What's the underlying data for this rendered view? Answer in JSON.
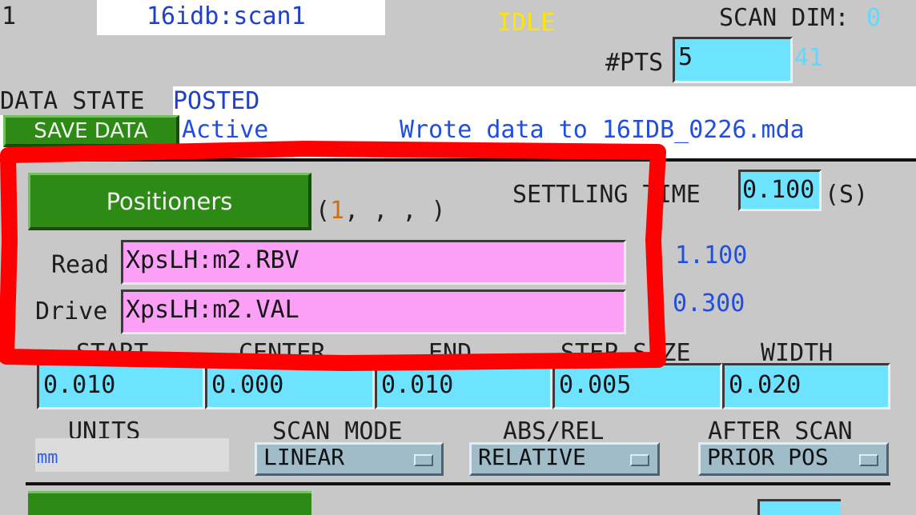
{
  "header": {
    "scan_index": "1",
    "scan_pv": "16idb:scan1",
    "status": "IDLE",
    "scan_dim_label": "SCAN DIM:",
    "scan_dim_value": "0",
    "npts_label": "#PTS",
    "npts_value": "5",
    "npts_max": "41"
  },
  "data_state": {
    "label": "DATA STATE",
    "value": "POSTED",
    "save_button": "SAVE DATA",
    "active": "Active",
    "message": "Wrote data to 16IDB_0226.mda"
  },
  "positioner": {
    "button_label": "Positioners",
    "num_prefix": "(",
    "num_highlight": "1",
    "num_rest": ", , , )",
    "settling_label": "SETTLING TIME",
    "settling_value": "0.100",
    "settling_unit": "(S)",
    "read_label": "Read",
    "read_pv": "XpsLH:m2.RBV",
    "read_value": "1.100",
    "drive_label": "Drive",
    "drive_pv": "XpsLH:m2.VAL",
    "drive_value": "0.300",
    "col_labels": [
      "START",
      "CENTER",
      "END",
      "STEP SIZE",
      "WIDTH"
    ],
    "values": [
      "0.010",
      "0.000",
      "0.010",
      "0.005",
      "0.020"
    ],
    "units_label": "UNITS",
    "units_value": "mm",
    "scan_mode_label": "SCAN MODE",
    "scan_mode_value": "LINEAR",
    "absrel_label": "ABS/REL",
    "absrel_value": "RELATIVE",
    "after_scan_label": "AFTER SCAN",
    "after_scan_value": "PRIOR POS"
  },
  "overlay": {
    "highlight_color": "#ff0000"
  },
  "colors": {
    "panel_bg": "#c8c8c8",
    "field_bg": "#6ee3ff",
    "pv_field_bg": "#fca0f7",
    "button_green": "#2c8a15",
    "status_yellow": "#ffe600"
  }
}
